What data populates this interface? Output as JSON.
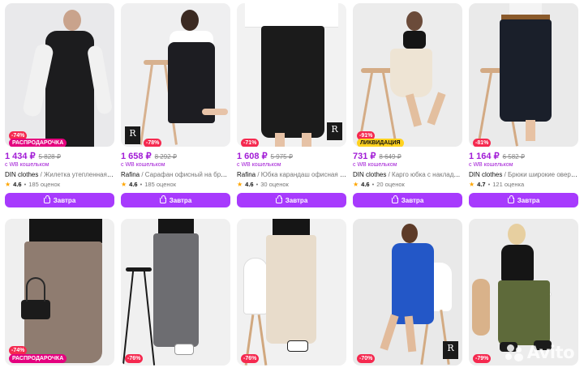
{
  "products_row1": [
    {
      "price": "1 434 ₽",
      "old_price": "5 828 ₽",
      "wallet": "с WB кошельком",
      "brand": "DIN clothes",
      "name": " / Жилетка утепленная бе...",
      "rating": "4.6",
      "reviews": "185 оценок",
      "discount": "-74%",
      "promo": "РАСПРОДАРОЧКА",
      "button": "Завтра"
    },
    {
      "price": "1 658 ₽",
      "old_price": "8 292 ₽",
      "wallet": "с WB кошельком",
      "brand": "Rafina",
      "name": " / Сарафан офисный на бретел...",
      "rating": "4.6",
      "reviews": "185 оценок",
      "discount": "-78%",
      "logo": "R",
      "button": "Завтра"
    },
    {
      "price": "1 608 ₽",
      "old_price": "5 975 ₽",
      "wallet": "с WB кошельком",
      "brand": "Rafina",
      "name": " / Юбка карандаш офисная с ра...",
      "rating": "4.6",
      "reviews": "30 оценок",
      "discount": "-71%",
      "logo": "R",
      "button": "Завтра"
    },
    {
      "price": "731 ₽",
      "old_price": "8 649 ₽",
      "wallet": "с WB кошельком",
      "brand": "DIN clothes",
      "name": " / Карго юбка с накладны...",
      "rating": "4.6",
      "reviews": "20 оценок",
      "discount": "-91%",
      "promo": "ЛИКВИДАЦИЯ",
      "button": "Завтра"
    },
    {
      "price": "1 164 ₽",
      "old_price": "6 582 ₽",
      "wallet": "с WB кошельком",
      "brand": "DIN clothes",
      "name": " / Брюки широкие оверса...",
      "rating": "4.7",
      "reviews": "121 оценка",
      "discount": "-81%",
      "button": "Завтра"
    }
  ],
  "products_row2": [
    {
      "discount": "-74%",
      "promo": "РАСПРОДАРОЧКА"
    },
    {
      "discount": "-76%"
    },
    {
      "discount": "-76%"
    },
    {
      "discount": "-70%",
      "logo": "R"
    },
    {
      "discount": "-79%"
    }
  ],
  "watermark": {
    "text": "Avito"
  },
  "colors": {
    "accent": "#a73afd",
    "price": "#a21cd6",
    "discount": "#f5294f",
    "promo_pink": "#e4007e",
    "promo_yellow": "#ffd21f"
  },
  "icons": {
    "star": "star-icon",
    "cart": "cart-icon",
    "brand_logo": "brand-r-logo"
  }
}
